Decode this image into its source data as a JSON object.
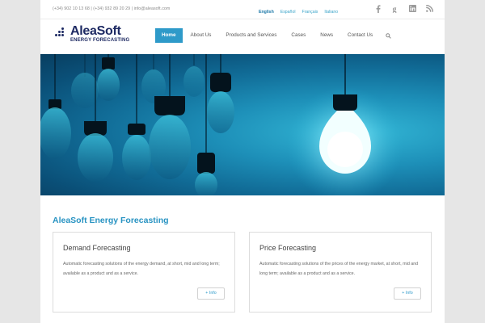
{
  "topbar": {
    "contact": "(+34) 902 10 13 68 | (+34) 932 89 20 29 | info@aleasoft.com",
    "languages": [
      {
        "label": "English",
        "active": true
      },
      {
        "label": "Español",
        "active": false
      },
      {
        "label": "Français",
        "active": false
      },
      {
        "label": "Italiano",
        "active": false
      }
    ],
    "social_icons": [
      "facebook-icon",
      "google-plus-icon",
      "linkedin-icon",
      "rss-icon"
    ]
  },
  "header": {
    "logo_text": "AleaSoft",
    "logo_subtext": "ENERGY FORECASTING",
    "nav": [
      {
        "label": "Home",
        "active": true
      },
      {
        "label": "About Us",
        "active": false
      },
      {
        "label": "Products and Services",
        "active": false
      },
      {
        "label": "Cases",
        "active": false
      },
      {
        "label": "News",
        "active": false
      },
      {
        "label": "Contact Us",
        "active": false
      }
    ],
    "search_icon": "search-icon"
  },
  "content": {
    "section_title": "AleaSoft Energy Forecasting",
    "cards": [
      {
        "title": "Demand Forecasting",
        "text": "Automatic forecasting solutions of the energy demand, at short, mid and long term; available as a product and as a service.",
        "button": "+ Info"
      },
      {
        "title": "Price Forecasting",
        "text": "Automatic forecasting solutions of the prices of the energy market, at short, mid and long term; available as a product and as a service.",
        "button": "+ Info"
      }
    ]
  },
  "colors": {
    "accent": "#2e9ac9",
    "logo": "#1e2a63",
    "title": "#2893c2",
    "background": "#e6e6e6"
  }
}
